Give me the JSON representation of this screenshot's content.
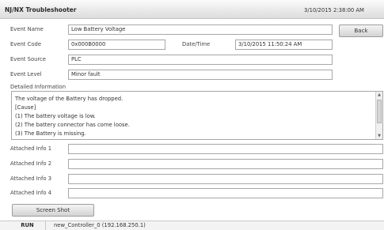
{
  "app": {
    "title": "NJ/NX Troubleshooter",
    "clock": "3/10/2015 2:38:00 AM"
  },
  "event": {
    "name_label": "Event Name",
    "name_value": "Low Battery Voltage",
    "code_label": "Event Code",
    "code_value": "0x000B0000",
    "datetime_label": "Date/Time",
    "datetime_value": "3/10/2015 11:50:24 AM",
    "source_label": "Event Source",
    "source_value": "PLC",
    "level_label": "Event Level",
    "level_value": "Minor fault"
  },
  "back_label": "Back",
  "detail": {
    "label": "Detailed Information",
    "lines": [
      "The voltage of the Battery has dropped.",
      "[Cause]",
      "(1) The battery voltage is low.",
      "(2) The battery connector has come loose.",
      "(3) The Battery is missing."
    ]
  },
  "attached": [
    {
      "label": "Attached Info 1",
      "value": ""
    },
    {
      "label": "Attached Info 2",
      "value": ""
    },
    {
      "label": "Attached Info 3",
      "value": ""
    },
    {
      "label": "Attached Info 4",
      "value": ""
    }
  ],
  "screenshot_label": "Screen Shot",
  "status": {
    "mode": "RUN",
    "connection": "new_Controller_0 (192.168.250.1)"
  },
  "colors": {
    "title_gradient_top": "#fbfbfb",
    "title_gradient_bottom": "#dcdcdc",
    "field_border": "#a7a7a7"
  }
}
